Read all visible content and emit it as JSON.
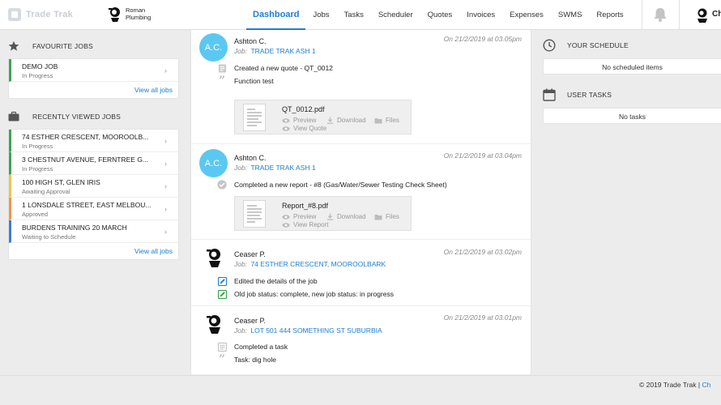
{
  "app": {
    "brand": "Trade Trak",
    "company": "Roman Plumbing"
  },
  "nav": {
    "items": [
      "Dashboard",
      "Jobs",
      "Tasks",
      "Scheduler",
      "Quotes",
      "Invoices",
      "Expenses",
      "SWMS",
      "Reports"
    ],
    "active": "Dashboard",
    "user_initial": "Ch"
  },
  "favourite_jobs": {
    "title": "FAVOURITE JOBS",
    "items": [
      {
        "name": "DEMO JOB",
        "status": "In Progress"
      }
    ],
    "view_all": "View all jobs"
  },
  "recent_jobs": {
    "title": "RECENTLY VIEWED JOBS",
    "items": [
      {
        "name": "74 ESTHER CRESCENT, MOOROOLB...",
        "status": "In Progress",
        "color": "#3aa653"
      },
      {
        "name": "3 CHESTNUT AVENUE, FERNTREE G...",
        "status": "In Progress",
        "color": "#3aa653"
      },
      {
        "name": "100 HIGH ST, GLEN IRIS",
        "status": "Awaiting Approval",
        "color": "#f2c14e"
      },
      {
        "name": "1 LONSDALE STREET, EAST MELBOU...",
        "status": "Approved",
        "color": "#f0944d"
      },
      {
        "name": "BURDENS TRAINING 20 MARCH",
        "status": "Waiting to Schedule",
        "color": "#3b7dd8"
      }
    ],
    "view_all": "View all jobs"
  },
  "feed": [
    {
      "user": "Ashton C.",
      "avatar": "A.C.",
      "job_label": "Job:",
      "job": "TRADE TRAK ASH 1",
      "time": "On 21/2/2019 at 03.05pm",
      "lines": [
        {
          "icon": "quote-doc-icon",
          "text": "Created a new quote - QT_0012"
        },
        {
          "icon": "quote-mark-icon",
          "text": "Function test"
        }
      ],
      "attachment": {
        "name": "QT_0012.pdf",
        "preview": "Preview",
        "download": "Download",
        "files": "Files",
        "view": "View Quote"
      }
    },
    {
      "user": "Ashton C.",
      "avatar": "A.C.",
      "job_label": "Job:",
      "job": "TRADE TRAK ASH 1",
      "time": "On 21/2/2019 at 03.04pm",
      "lines": [
        {
          "icon": "check-circle-icon",
          "text": "Completed a new report - #8 (Gas/Water/Sewer Testing Check Sheet)"
        }
      ],
      "attachment": {
        "name": "Report_#8.pdf",
        "preview": "Preview",
        "download": "Download",
        "files": "Files",
        "view": "View Report"
      }
    },
    {
      "user": "Ceaser P.",
      "job_label": "Job:",
      "job": "74 ESTHER CRESCENT, MOOROOLBARK",
      "time": "On 21/2/2019 at 03.02pm",
      "lines": [
        {
          "icon": "edit-blue-icon",
          "text": "Edited the details of the job"
        },
        {
          "icon": "edit-green-icon",
          "text": "Old job status: complete, new job status: in progress"
        }
      ]
    },
    {
      "user": "Ceaser P.",
      "job_label": "Job:",
      "job": "LOT 501 444 SOMETHING ST SUBURBIA",
      "time": "On 21/2/2019 at 03.01pm",
      "lines": [
        {
          "icon": "task-list-icon",
          "text": "Completed a task"
        },
        {
          "icon": "quote-mark-icon",
          "text": "Task: dig hole"
        }
      ]
    }
  ],
  "schedule": {
    "title": "YOUR SCHEDULE",
    "empty": "No scheduled items"
  },
  "user_tasks": {
    "title": "USER TASKS",
    "empty": "No tasks"
  },
  "footer": {
    "copyright": "© 2019 Trade Trak |",
    "link": "Ch"
  },
  "colors": {
    "accent": "#1c7ed6",
    "avatar": "#5bc8f2",
    "in_progress": "#3aa653"
  }
}
